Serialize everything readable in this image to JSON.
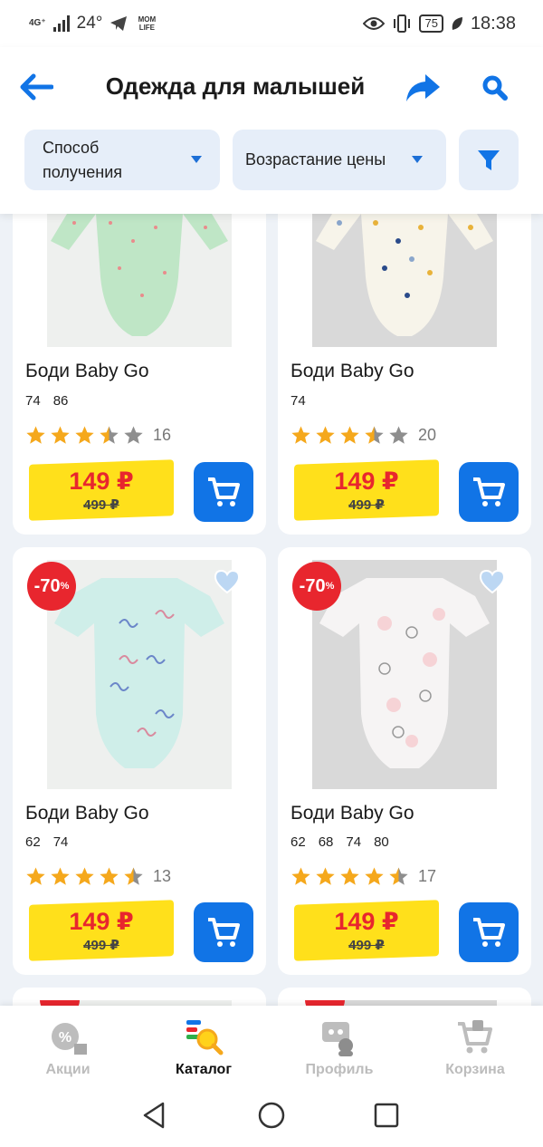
{
  "status_bar": {
    "network": "4G⁺",
    "temperature": "24°",
    "app_badge": "MOM LIFE",
    "battery": "75",
    "time": "18:38"
  },
  "header": {
    "title": "Одежда для малышей",
    "back_icon": "arrow-left-icon",
    "share_icon": "share-icon",
    "search_icon": "search-icon"
  },
  "filters": {
    "delivery_method": "Способ получения",
    "sort": "Возрастание цены",
    "filter_icon": "funnel-icon"
  },
  "colors": {
    "accent": "#1174e6",
    "price_tag": "#ffe01b",
    "price_red": "#e8262e",
    "star": "#f5a81c"
  },
  "products": [
    {
      "name": "Боди Baby Go",
      "sizes": [
        "74",
        "86"
      ],
      "rating": 3.5,
      "reviews": "16",
      "price": "149 ₽",
      "old_price": "499 ₽"
    },
    {
      "name": "Боди Baby Go",
      "sizes": [
        "74"
      ],
      "rating": 3.5,
      "reviews": "20",
      "price": "149 ₽",
      "old_price": "499 ₽"
    },
    {
      "name": "Боди Baby Go",
      "sizes": [
        "62",
        "74"
      ],
      "rating": 4.5,
      "reviews": "13",
      "price": "149 ₽",
      "old_price": "499 ₽",
      "discount": "-70",
      "discount_suffix": "%"
    },
    {
      "name": "Боди Baby Go",
      "sizes": [
        "62",
        "68",
        "74",
        "80"
      ],
      "rating": 4.5,
      "reviews": "17",
      "price": "149 ₽",
      "old_price": "499 ₽",
      "discount": "-70",
      "discount_suffix": "%"
    }
  ],
  "bottom_nav": [
    {
      "label": "Акции",
      "icon": "percent-tag-icon",
      "active": false
    },
    {
      "label": "Каталог",
      "icon": "catalog-search-icon",
      "active": true
    },
    {
      "label": "Профиль",
      "icon": "profile-card-icon",
      "active": false
    },
    {
      "label": "Корзина",
      "icon": "cart-icon",
      "active": false
    }
  ]
}
